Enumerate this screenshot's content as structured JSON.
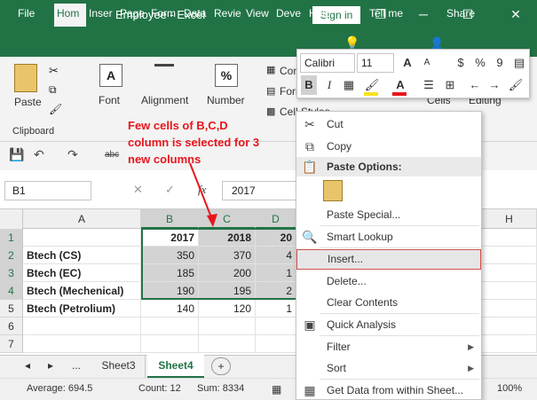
{
  "title": {
    "app": "Employee  -  Excel",
    "signin": "Sign in"
  },
  "window": {
    "restore": "❐",
    "minimize": "─",
    "maximize": "☐",
    "close": "✕"
  },
  "tabs": [
    "File",
    "Hom",
    "Inser",
    "Page",
    "Form",
    "Data",
    "Revie",
    "View",
    "Deve",
    "Help"
  ],
  "tellme": "Tell me",
  "share": "Share",
  "ribbon": {
    "paste": "Paste",
    "clipboard": "Clipboard",
    "font": "Font",
    "alignment": "Alignment",
    "number": "Number",
    "number_glyph": "%",
    "font_glyph": "A",
    "conditional": "Con",
    "format_table": "Form",
    "cell_styles": "Cell Styles",
    "cells": "Cells",
    "editing": "Editing"
  },
  "qat": {
    "abc": "abc"
  },
  "formula_bar": {
    "namebox": "B1",
    "fx": "fx",
    "value": "2017"
  },
  "columns": [
    "A",
    "B",
    "C",
    "D",
    "H"
  ],
  "rows": [
    {
      "num": "1",
      "a": "",
      "b": "2017",
      "c": "2018",
      "d": "20"
    },
    {
      "num": "2",
      "a": "Btech (CS)",
      "b": "350",
      "c": "370",
      "d": "4"
    },
    {
      "num": "3",
      "a": "Btech (EC)",
      "b": "185",
      "c": "200",
      "d": "1"
    },
    {
      "num": "4",
      "a": "Btech (Mechenical)",
      "b": "190",
      "c": "195",
      "d": "2"
    },
    {
      "num": "5",
      "a": "Btech (Petrolium)",
      "b": "140",
      "c": "120",
      "d": "1"
    },
    {
      "num": "6",
      "a": "",
      "b": "",
      "c": "",
      "d": ""
    },
    {
      "num": "7",
      "a": "",
      "b": "",
      "c": "",
      "d": ""
    }
  ],
  "annotation": "Few cells of B,C,D column is selected for 3 new columns",
  "sheets": {
    "ellipsis": "...",
    "sheet3": "Sheet3",
    "sheet4": "Sheet4",
    "add": "+"
  },
  "status": {
    "average": "Average: 694.5",
    "count": "Count: 12",
    "sum": "Sum: 8334",
    "zoom": "100%"
  },
  "mini_toolbar": {
    "font": "Calibri",
    "size": "11",
    "grow": "A",
    "shrink": "A",
    "currency": "$",
    "percent": "%",
    "comma": "9",
    "bold": "B",
    "italic": "I",
    "font_color": "A",
    "highlight_color": "#f7e31c",
    "font_color_bar": "#e8161c"
  },
  "context_menu": {
    "cut": "Cut",
    "copy": "Copy",
    "paste_options": "Paste Options:",
    "paste_special": "Paste Special...",
    "smart_lookup": "Smart Lookup",
    "insert": "Insert...",
    "delete": "Delete...",
    "clear": "Clear Contents",
    "quick_analysis": "Quick Analysis",
    "filter": "Filter",
    "sort": "Sort",
    "get_data": "Get Data from within Sheet..."
  },
  "colors": {
    "excel_green": "#217346",
    "annotation_red": "#e8161c"
  }
}
